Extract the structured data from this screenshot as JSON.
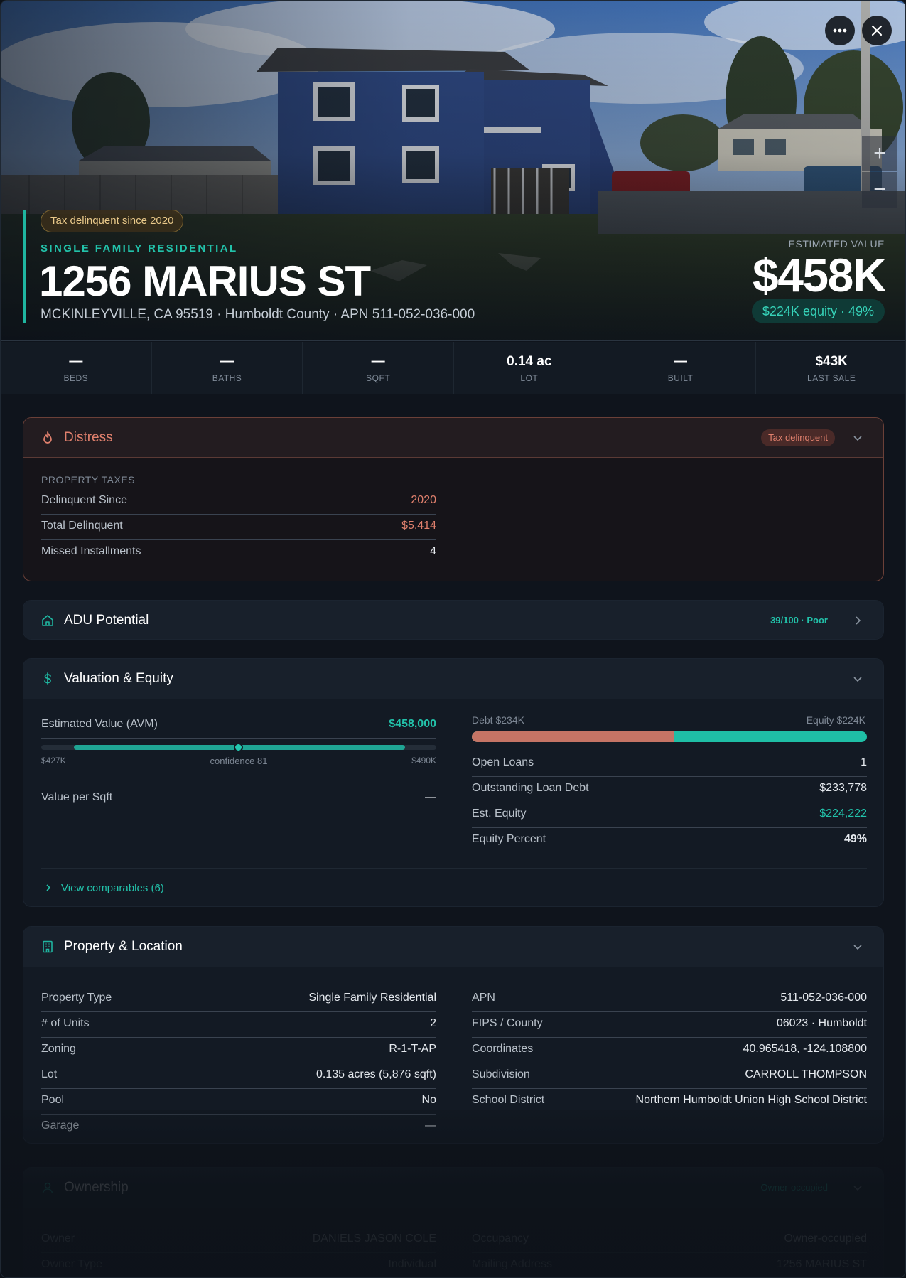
{
  "hero": {
    "tax_badge": "Tax delinquent since 2020",
    "property_type": "SINGLE FAMILY RESIDENTIAL",
    "address": "1256 MARIUS ST",
    "subaddress": "MCKINLEYVILLE, CA 95519 · Humboldt County · APN 511-052-036-000",
    "estimated_label": "ESTIMATED VALUE",
    "estimated_value": "$458K",
    "equity_pill": "$224K equity · 49%",
    "more_icon": "more-horizontal-icon",
    "close_icon": "close-icon",
    "zoom_in": "+",
    "zoom_out": "−"
  },
  "stats": [
    {
      "value": "—",
      "label": "BEDS"
    },
    {
      "value": "—",
      "label": "BATHS"
    },
    {
      "value": "—",
      "label": "SQFT"
    },
    {
      "value": "0.14 ac",
      "label": "LOT"
    },
    {
      "value": "—",
      "label": "BUILT"
    },
    {
      "value": "$43K",
      "label": "LAST SALE"
    }
  ],
  "distress": {
    "title": "Distress",
    "badge": "Tax delinquent",
    "section_label": "PROPERTY TAXES",
    "rows": [
      {
        "label": "Delinquent Since",
        "value": "2020"
      },
      {
        "label": "Total Delinquent",
        "value": "$5,414"
      },
      {
        "label": "Missed Installments",
        "value": "4"
      }
    ]
  },
  "adu": {
    "title": "ADU Potential",
    "badge": "39/100 · Poor"
  },
  "valuation": {
    "title": "Valuation & Equity",
    "avm_label": "Estimated Value (AVM)",
    "avm_value": "$458,000",
    "range_low": "$427K",
    "range_high": "$490K",
    "confidence": "confidence 81",
    "value_per_sqft_label": "Value per Sqft",
    "value_per_sqft": "—",
    "debt_label": "Debt $234K",
    "equity_label": "Equity $224K",
    "debt_fraction": 0.51,
    "rows": [
      {
        "label": "Open Loans",
        "value": "1"
      },
      {
        "label": "Outstanding Loan Debt",
        "value": "$233,778"
      },
      {
        "label": "Est. Equity",
        "value": "$224,222"
      },
      {
        "label": "Equity Percent",
        "value": "49%"
      }
    ],
    "comparables_link": "View comparables (6)"
  },
  "property": {
    "title": "Property & Location",
    "left": [
      {
        "label": "Property Type",
        "value": "Single Family Residential"
      },
      {
        "label": "# of Units",
        "value": "2"
      },
      {
        "label": "Zoning",
        "value": "R-1-T-AP"
      },
      {
        "label": "Lot",
        "value": "0.135 acres (5,876 sqft)"
      },
      {
        "label": "Pool",
        "value": "No"
      },
      {
        "label": "Garage",
        "value": "—"
      }
    ],
    "right": [
      {
        "label": "APN",
        "value": "511-052-036-000"
      },
      {
        "label": "FIPS / County",
        "value": "06023 · Humboldt"
      },
      {
        "label": "Coordinates",
        "value": "40.965418, -124.108800"
      },
      {
        "label": "Subdivision",
        "value": "CARROLL THOMPSON"
      },
      {
        "label": "School District",
        "value": "Northern Humboldt Union High School District"
      }
    ]
  },
  "ownership": {
    "title": "Ownership",
    "badge": "Owner-occupied",
    "left": [
      {
        "label": "Owner",
        "value": "DANIELS JASON COLE"
      },
      {
        "label": "Owner Type",
        "value": "Individual"
      }
    ],
    "right": [
      {
        "label": "Occupancy",
        "value": "Owner-occupied"
      },
      {
        "label": "Mailing Address",
        "value": "1256 MARIUS ST"
      }
    ]
  },
  "colors": {
    "accent": "#1fb5a0",
    "distress": "#e0806d",
    "tax_badge": "#e9c98a",
    "debt_bar": "#c57465",
    "equity_bar": "#1fbfa6"
  }
}
